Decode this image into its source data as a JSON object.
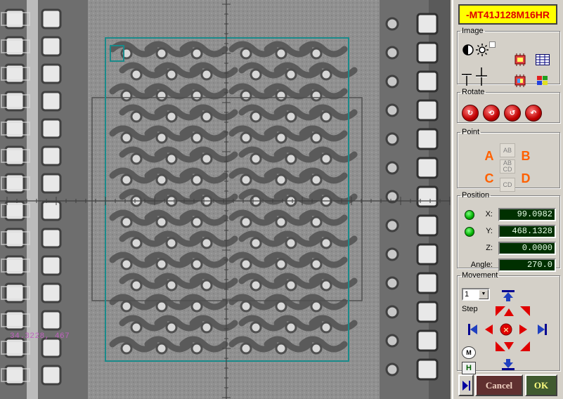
{
  "device_title": "-MT41J128M16HR",
  "colors": {
    "title_bg": "#ffff00",
    "title_text": "#e00000",
    "value_bg": "#003000",
    "value_text": "#e8ffe8",
    "overlay_teal": "#1a8a8a",
    "readout": "#c060c0",
    "cancel_bg": "#603030",
    "ok_bg": "#405a30"
  },
  "camera": {
    "coord_readout": "34.3228, 467"
  },
  "image_group": {
    "label": "Image",
    "icons": [
      "contrast-icon",
      "brightness-icon",
      "checkbox-icon",
      "chip-icon",
      "grid-icon",
      "crosshair-icon",
      "chip-color-icon",
      "palette-icon"
    ]
  },
  "rotate_group": {
    "label": "Rotate",
    "buttons": [
      "rotate-90-icon",
      "rotate-180-icon",
      "rotate-cw-icon",
      "rotate-ccw-icon"
    ]
  },
  "point_group": {
    "label": "Point",
    "a": "A",
    "b": "B",
    "c": "C",
    "d": "D",
    "ab": "AB",
    "abcd_top": "AB",
    "abcd_bottom": "CD",
    "cd": "CD"
  },
  "position_group": {
    "label": "Position",
    "x_label": "X:",
    "x_value": "99.0982",
    "y_label": "Y:",
    "y_value": "468.1328",
    "z_label": "Z:",
    "z_value": "0.0000",
    "angle_label": "Angle:",
    "angle_value": "270.0"
  },
  "movement_group": {
    "label": "Movement",
    "step_select_value": "1",
    "step_label": "Step",
    "m_button": "M",
    "h_button": "H"
  },
  "footer": {
    "cancel_label": "Cancel",
    "ok_label": "OK"
  }
}
